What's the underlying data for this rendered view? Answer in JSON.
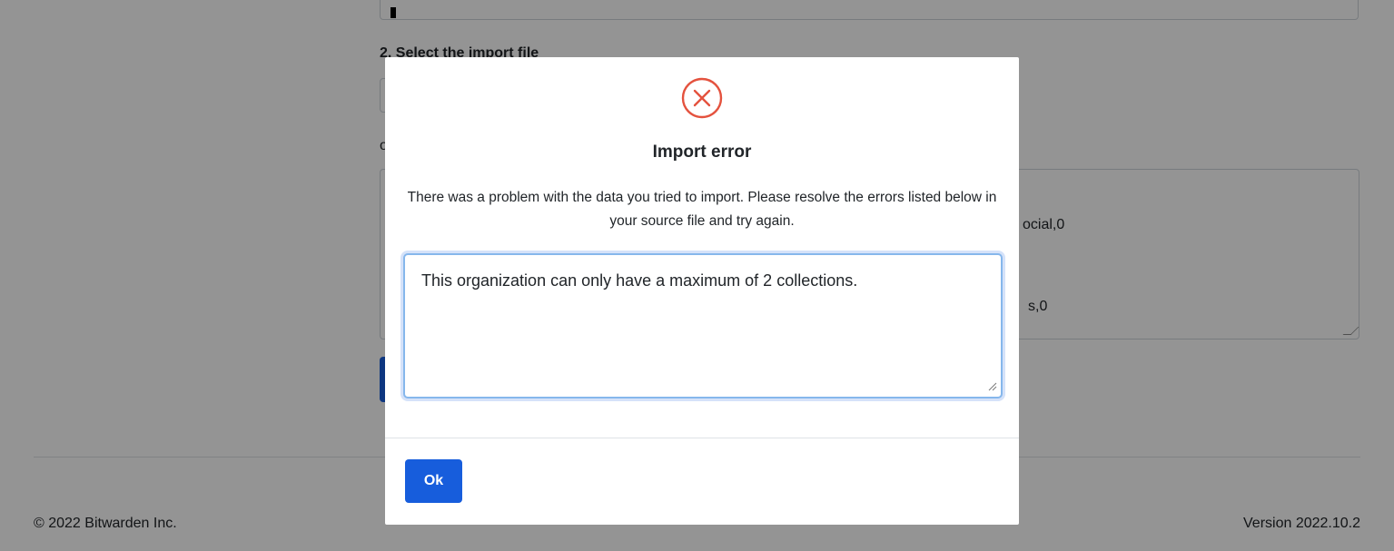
{
  "background": {
    "step_label": "2. Select the import file",
    "or_label": "or",
    "textarea_line_1": "ocial,0",
    "textarea_line_2": "s,0",
    "footer": {
      "copyright": "© 2022 Bitwarden Inc.",
      "version": "Version 2022.10.2"
    }
  },
  "modal": {
    "icon": "error-circle-x-icon",
    "title": "Import error",
    "message": "There was a problem with the data you tried to import. Please resolve the errors listed below in your source file and try again.",
    "errors_text": "This organization can only have a maximum of 2 collections.",
    "ok_label": "Ok"
  },
  "colors": {
    "primary": "#175ddc",
    "error_red": "#e4523e",
    "backdrop": "rgba(0,0,0,0.42)",
    "focus_border": "#86b7ec"
  }
}
